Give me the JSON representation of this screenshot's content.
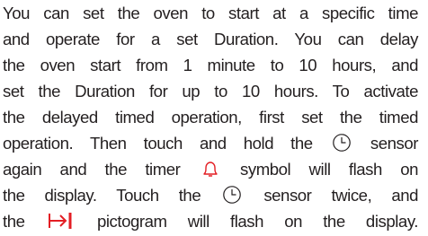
{
  "document": {
    "lines": [
      {
        "text": "You can set the oven to start at a specific time"
      },
      {
        "text": "and operate for a set Duration. You can delay"
      },
      {
        "text": "the oven start from 1 minute to 10 hours, and"
      },
      {
        "text": "set the Duration for up to 10 hours. To activate"
      },
      {
        "text": "the delayed timed operation, first set the timed"
      },
      {
        "before": "operation. Then touch and hold the",
        "after": "sensor"
      },
      {
        "before": "again and the timer",
        "after": "symbol will flash on"
      },
      {
        "before": "the display. Touch the",
        "after": "sensor twice, and"
      },
      {
        "before": "the",
        "after": "pictogram will flash on the display."
      }
    ]
  },
  "icons": {
    "timer_sensor": "clock-icon",
    "timer_symbol": "bell-icon",
    "duration_pictogram": "arrow-to-bar-icon"
  },
  "colors": {
    "text": "#231f20",
    "icon_red": "#e31e24",
    "icon_outline": "#231f20"
  }
}
